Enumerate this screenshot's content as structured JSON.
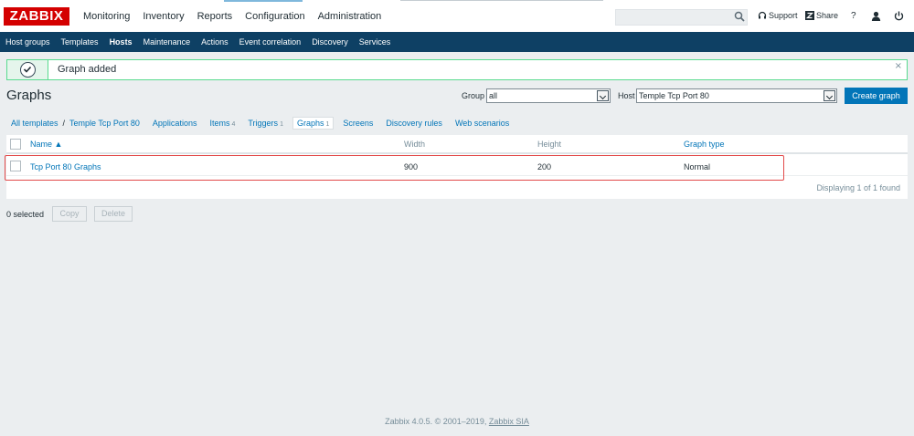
{
  "brand": {
    "logo": "ZABBIX",
    "color": "#d40000"
  },
  "main_nav": [
    {
      "label": "Monitoring"
    },
    {
      "label": "Inventory"
    },
    {
      "label": "Reports"
    },
    {
      "label": "Configuration",
      "active": true
    },
    {
      "label": "Administration"
    }
  ],
  "header_tools": {
    "support": "Support",
    "share": "Share",
    "help": "?"
  },
  "sub_nav": [
    {
      "label": "Host groups"
    },
    {
      "label": "Templates"
    },
    {
      "label": "Hosts",
      "active": true
    },
    {
      "label": "Maintenance"
    },
    {
      "label": "Actions"
    },
    {
      "label": "Event correlation"
    },
    {
      "label": "Discovery"
    },
    {
      "label": "Services"
    }
  ],
  "message": {
    "text": "Graph added",
    "close": "×"
  },
  "page": {
    "title": "Graphs"
  },
  "filters": {
    "group_label": "Group",
    "group_value": "all",
    "host_label": "Host",
    "host_value": "Temple Tcp Port 80"
  },
  "create_button": "Create graph",
  "breadcrumb": {
    "all_templates": "All templates",
    "separator": "/",
    "host": "Temple Tcp Port 80",
    "tabs": [
      {
        "label": "Applications",
        "count": ""
      },
      {
        "label": "Items",
        "count": "4"
      },
      {
        "label": "Triggers",
        "count": "1"
      },
      {
        "label": "Graphs",
        "count": "1",
        "selected": true
      },
      {
        "label": "Screens",
        "count": ""
      },
      {
        "label": "Discovery rules",
        "count": ""
      },
      {
        "label": "Web scenarios",
        "count": ""
      }
    ]
  },
  "table": {
    "columns": {
      "name": "Name ▲",
      "width": "Width",
      "height": "Height",
      "graph_type": "Graph type"
    },
    "rows": [
      {
        "name": "Tcp Port 80 Graphs",
        "width": "900",
        "height": "200",
        "graph_type": "Normal"
      }
    ],
    "displaying": "Displaying 1 of 1 found"
  },
  "bulk_actions": {
    "selected": "0 selected",
    "copy": "Copy",
    "delete": "Delete"
  },
  "footer": {
    "text": "Zabbix 4.0.5. © 2001–2019,",
    "link": "Zabbix SIA"
  }
}
